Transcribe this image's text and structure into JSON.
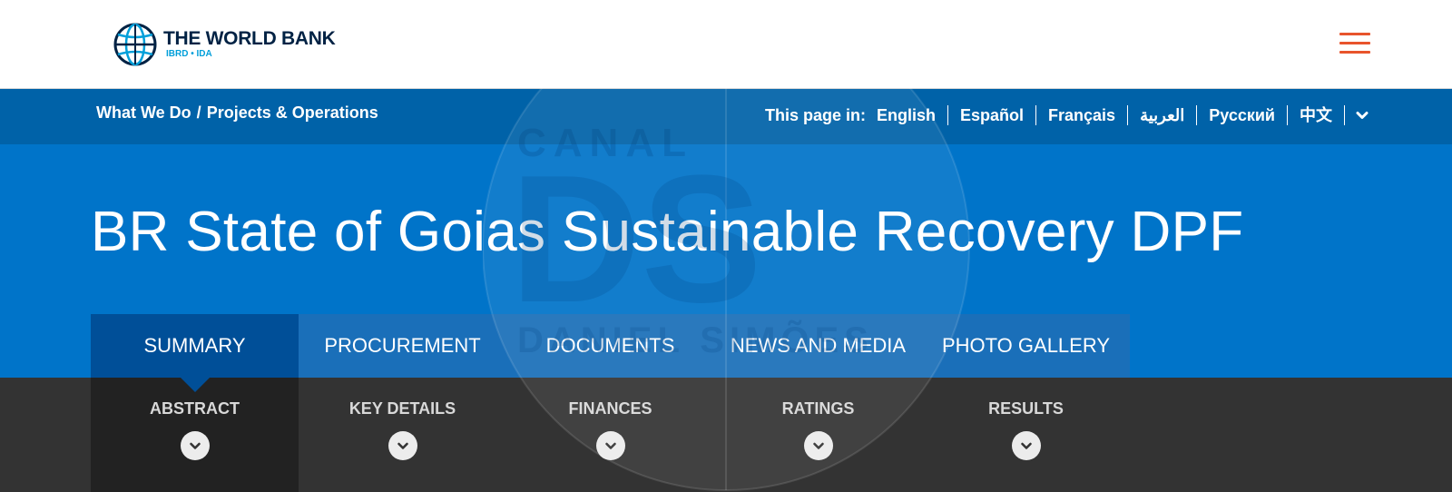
{
  "header": {
    "brand_name": "THE WORLD BANK",
    "brand_sub": "IBRD • IDA",
    "menu_icon": "hamburger-icon",
    "accent_color": "#e8542c"
  },
  "breadcrumb": {
    "items": [
      "What We Do",
      "Projects & Operations"
    ],
    "separator": "/"
  },
  "languages": {
    "label": "This page in:",
    "items": [
      "English",
      "Español",
      "Français",
      "العربية",
      "Русский",
      "中文"
    ],
    "more_icon": "chevron-down-icon"
  },
  "page": {
    "title": "BR State of Goias Sustainable Recovery DPF"
  },
  "tabs": {
    "items": [
      "SUMMARY",
      "PROCUREMENT",
      "DOCUMENTS",
      "NEWS AND MEDIA",
      "PHOTO GALLERY"
    ],
    "active": "SUMMARY"
  },
  "subnav": {
    "items": [
      "ABSTRACT",
      "KEY DETAILS",
      "FINANCES",
      "RATINGS",
      "RESULTS"
    ],
    "active": "ABSTRACT",
    "icon": "chevron-down-icon"
  },
  "watermark": {
    "line1": "CANAL",
    "monogram": "DS",
    "line2": "DANIEL SIMÕES"
  },
  "colors": {
    "primary_blue": "#0074c9",
    "nav_blue": "#0062a8",
    "tab_active": "#004f98",
    "subnav_bg": "#333333",
    "brand_navy": "#002244",
    "brand_cyan": "#009fda"
  }
}
